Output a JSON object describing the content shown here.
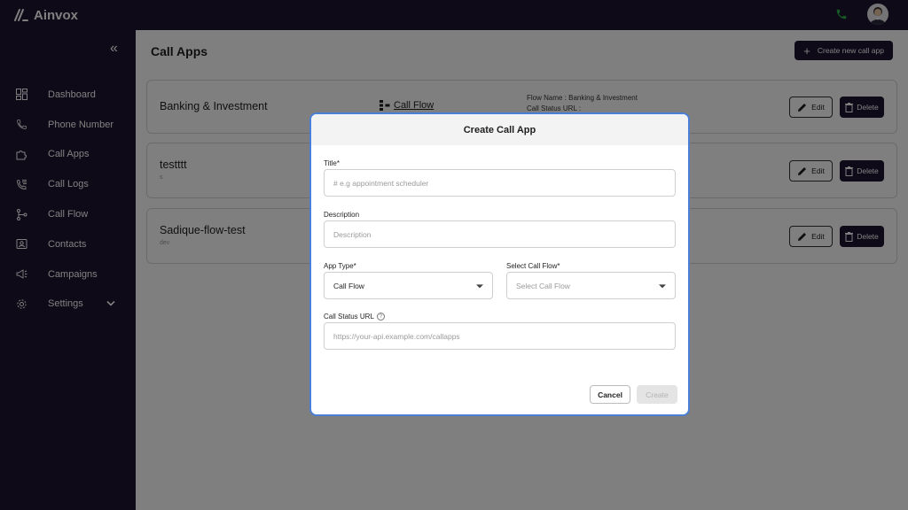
{
  "app": {
    "name": "Ainvox"
  },
  "header": {
    "phone_icon": "phone-icon",
    "avatar_icon": "user-avatar"
  },
  "sidebar": {
    "collapse_icon": "double-chevron-left-icon",
    "items": [
      {
        "label": "Dashboard",
        "icon": "dashboard-icon"
      },
      {
        "label": "Phone Number",
        "icon": "phone-icon"
      },
      {
        "label": "Call Apps",
        "icon": "puzzle-icon"
      },
      {
        "label": "Call Logs",
        "icon": "call-log-icon"
      },
      {
        "label": "Call Flow",
        "icon": "flow-icon"
      },
      {
        "label": "Contacts",
        "icon": "contacts-icon"
      },
      {
        "label": "Campaigns",
        "icon": "megaphone-icon"
      },
      {
        "label": "Settings",
        "icon": "gear-icon"
      }
    ]
  },
  "main": {
    "title": "Call Apps",
    "create_button": "Create new call app",
    "cards": [
      {
        "name": "Banking & Investment",
        "sub": "",
        "link": "Call Flow",
        "meta_line1": "Flow Name : Banking & Investment",
        "meta_line2": "Call Status URL : "
      },
      {
        "name": "testttt",
        "sub": "s",
        "link": "",
        "meta_line1": "",
        "meta_line2": ""
      },
      {
        "name": "Sadique-flow-test",
        "sub": "dev",
        "link": "",
        "meta_line1": "",
        "meta_line2": ""
      }
    ],
    "edit_label": "Edit",
    "delete_label": "Delete"
  },
  "modal": {
    "title": "Create Call App",
    "title_label": "Title*",
    "title_placeholder": "# e.g appointment scheduler",
    "description_label": "Description",
    "description_placeholder": "Description",
    "app_type_label": "App Type*",
    "app_type_value": "Call Flow",
    "call_flow_label": "Select Call Flow*",
    "call_flow_placeholder": "Select Call Flow",
    "status_url_label": "Call Status URL",
    "status_url_placeholder": "https://your-api.example.com/callapps",
    "cancel_label": "Cancel",
    "create_label": "Create"
  },
  "colors": {
    "nav_bg": "#1c1530",
    "modal_border": "#4a7fd8",
    "phone_green": "#2bb34a"
  }
}
